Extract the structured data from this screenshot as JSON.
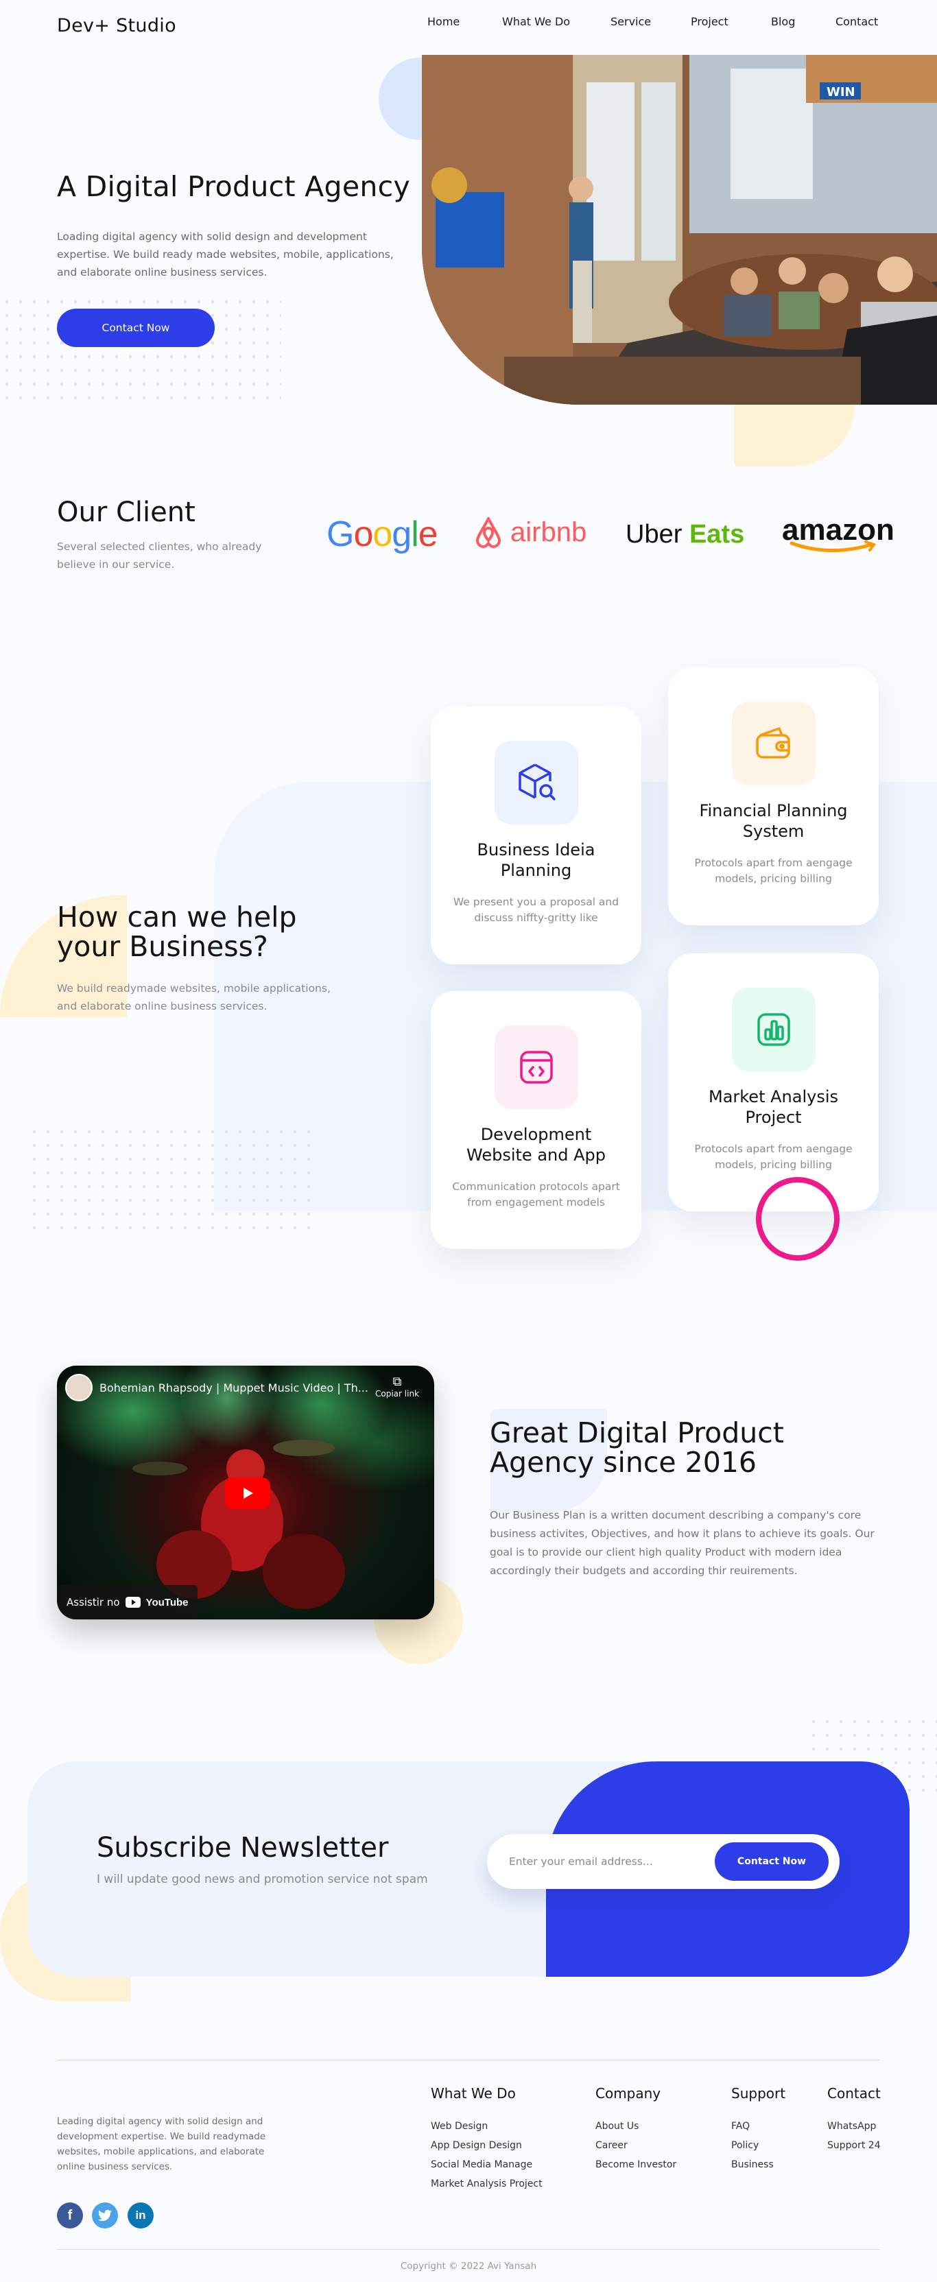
{
  "nav": {
    "logo": "Dev+ Studio",
    "items": [
      "Home",
      "What We Do",
      "Service",
      "Project",
      "Blog",
      "Contact"
    ]
  },
  "hero": {
    "title": "A Digital Product Agency",
    "description": "Loading digital agency with solid design and development expertise. We build ready made websites, mobile, applications, and elaborate online business services.",
    "cta": "Contact Now"
  },
  "clients": {
    "title": "Our Client",
    "description": "Several selected clientes, who already believe in our service.",
    "logos": {
      "google": "Google",
      "airbnb": "airbnb",
      "uber": "Uber",
      "eats": "Eats",
      "amazon": "amazon"
    }
  },
  "services": {
    "title": "How can we help your Business?",
    "description": "We build readymade websites, mobile applications, and elaborate online business services.",
    "cards": [
      {
        "title": "Business Ideia Planning",
        "desc": "We present you a proposal and discuss niffty-gritty like"
      },
      {
        "title": "Financial Planning System",
        "desc": "Protocols apart from aengage models, pricing billing"
      },
      {
        "title": "Development Website and App",
        "desc": "Communication protocols apart from engagement models"
      },
      {
        "title": "Market Analysis Project",
        "desc": "Protocols apart from aengage models, pricing billing"
      }
    ]
  },
  "video": {
    "title": "Bohemian Rhapsody | Muppet Music Video | Th...",
    "copy_link": "Copiar link",
    "watch_on": "Assistir no",
    "youtube": "YouTube"
  },
  "about": {
    "title": "Great Digital Product Agency since 2016",
    "description": "Our Business Plan is a written document describing a company's core business activites, Objectives, and how it plans to achieve its goals. Our goal is to provide our client high quality Product with modern idea accordingly their budgets and according thir reuirements."
  },
  "newsletter": {
    "title": "Subscribe Newsletter",
    "subtitle": "I will update good news and promotion service not spam",
    "placeholder": "Enter your email address...",
    "button": "Contact Now"
  },
  "footer": {
    "description": "Leading digital agency with solid design and development expertise. We build readymade websites, mobile applications, and elaborate online business services.",
    "columns": [
      {
        "title": "What We Do",
        "links": [
          "Web Design",
          "App Design Design",
          "Social Media Manage",
          "Market Analysis Project"
        ]
      },
      {
        "title": "Company",
        "links": [
          "About Us",
          "Career",
          "Become Investor"
        ]
      },
      {
        "title": "Support",
        "links": [
          "FAQ",
          "Policy",
          "Business"
        ]
      },
      {
        "title": "Contact",
        "links": [
          "WhatsApp",
          "Support 24"
        ]
      }
    ],
    "social": {
      "facebook": "f",
      "twitter": "t",
      "linkedin": "in"
    },
    "copyright": "Copyright © 2022 Avi Yansah"
  },
  "colors": {
    "primary": "#2d3de8",
    "accent_yellow": "#fff1d4",
    "accent_pink": "#ec1a8a",
    "light_blue": "#f0f5fe"
  }
}
